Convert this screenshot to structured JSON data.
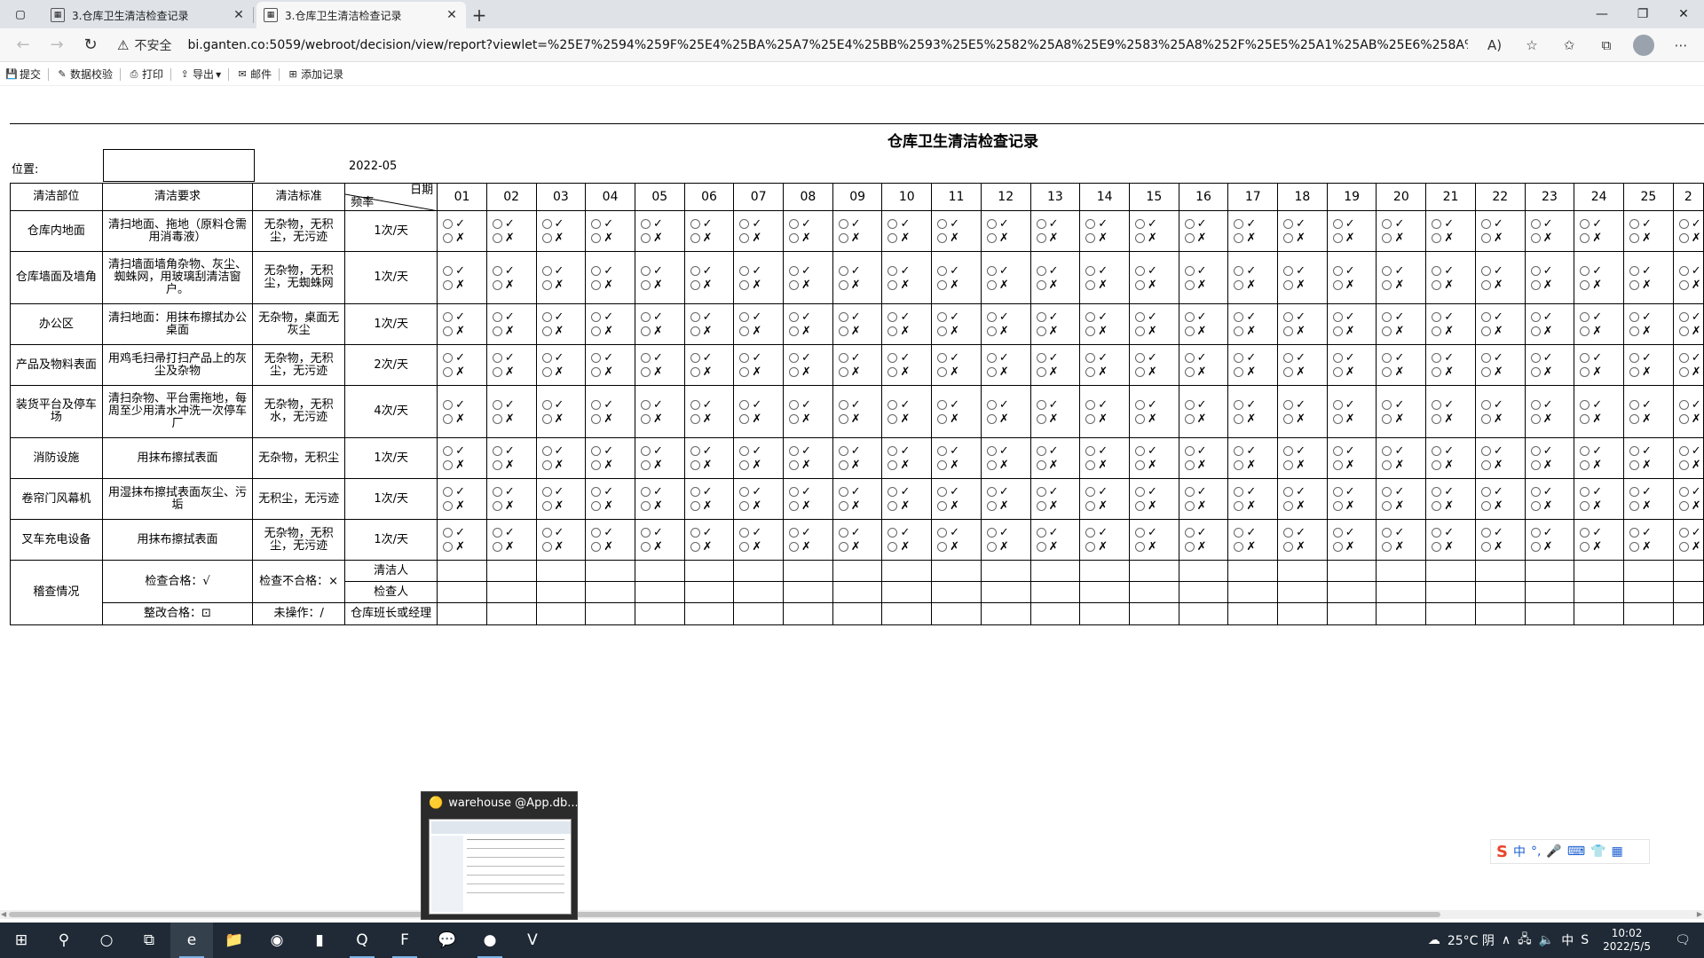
{
  "browser": {
    "tabs": [
      {
        "title": "3.仓库卫生清洁检查记录",
        "active": false
      },
      {
        "title": "3.仓库卫生清洁检查记录",
        "active": true
      }
    ],
    "insecure_label": "不安全",
    "url": "bi.ganten.co:5059/webroot/decision/view/report?viewlet=%25E7%2594%259F%25E4%25BA%25A7%25E4%25BB%2593%25E5%2582%25A8%25E9%2583%25A8%252F%25E5%25A1%25AB%25E6%258A%25A5%252F%25E7%2..."
  },
  "toolbar": {
    "submit": "提交",
    "validate": "数据校验",
    "print": "打印",
    "export": "导出",
    "mail": "邮件",
    "add_record": "添加记录"
  },
  "report": {
    "title": "仓库卫生清洁检查记录",
    "location_label": "位置:",
    "month": "2022-05",
    "headers": {
      "area": "清洁部位",
      "requirement": "清洁要求",
      "standard": "清洁标准",
      "date": "日期",
      "frequency": "频率"
    },
    "days": [
      "01",
      "02",
      "03",
      "04",
      "05",
      "06",
      "07",
      "08",
      "09",
      "10",
      "11",
      "12",
      "13",
      "14",
      "15",
      "16",
      "17",
      "18",
      "19",
      "20",
      "21",
      "22",
      "23",
      "24",
      "25",
      "2"
    ],
    "options": {
      "ok": "✓",
      "ng": "✗"
    },
    "rows": [
      {
        "area": "仓库内地面",
        "requirement": "清扫地面、拖地（原料仓需用消毒液）",
        "standard": "无杂物，无积尘，无污迹",
        "frequency": "1次/天"
      },
      {
        "area": "仓库墙面及墙角",
        "requirement": "清扫墙面墙角杂物、灰尘、蜘蛛网，用玻璃刮清洁窗户。",
        "standard": "无杂物，无积尘，无蜘蛛网",
        "frequency": "1次/天"
      },
      {
        "area": "办公区",
        "requirement": "清扫地面：用抹布擦拭办公桌面",
        "standard": "无杂物，桌面无灰尘",
        "frequency": "1次/天"
      },
      {
        "area": "产品及物料表面",
        "requirement": "用鸡毛扫帚打扫产品上的灰尘及杂物",
        "standard": "无杂物，无积尘，无污迹",
        "frequency": "2次/天"
      },
      {
        "area": "装货平台及停车场",
        "requirement": "清扫杂物、平台需拖地，每周至少用清水冲洗一次停车厂",
        "standard": "无杂物，无积水，无污迹",
        "frequency": "4次/天"
      },
      {
        "area": "消防设施",
        "requirement": "用抹布擦拭表面",
        "standard": "无杂物，无积尘",
        "frequency": "1次/天"
      },
      {
        "area": "卷帘门风幕机",
        "requirement": "用湿抹布擦拭表面灰尘、污垢",
        "standard": "无积尘，无污迹",
        "frequency": "1次/天"
      },
      {
        "area": "叉车充电设备",
        "requirement": "用抹布擦拭表面",
        "standard": "无杂物，无积尘，无污迹",
        "frequency": "1次/天"
      }
    ],
    "footer": {
      "label": "稽查情况",
      "pass": "检查合格：√",
      "fail": "检查不合格：×",
      "fixed": "整改合格：⊡",
      "notdone": "未操作：/",
      "cleaner": "清洁人",
      "inspector": "检查人",
      "manager": "仓库班长或经理"
    }
  },
  "preview": {
    "title": "warehouse @App.db..."
  },
  "taskbar": {
    "weather": "25°C 阴",
    "ime": "中",
    "time": "10:02",
    "date": "2022/5/5"
  }
}
